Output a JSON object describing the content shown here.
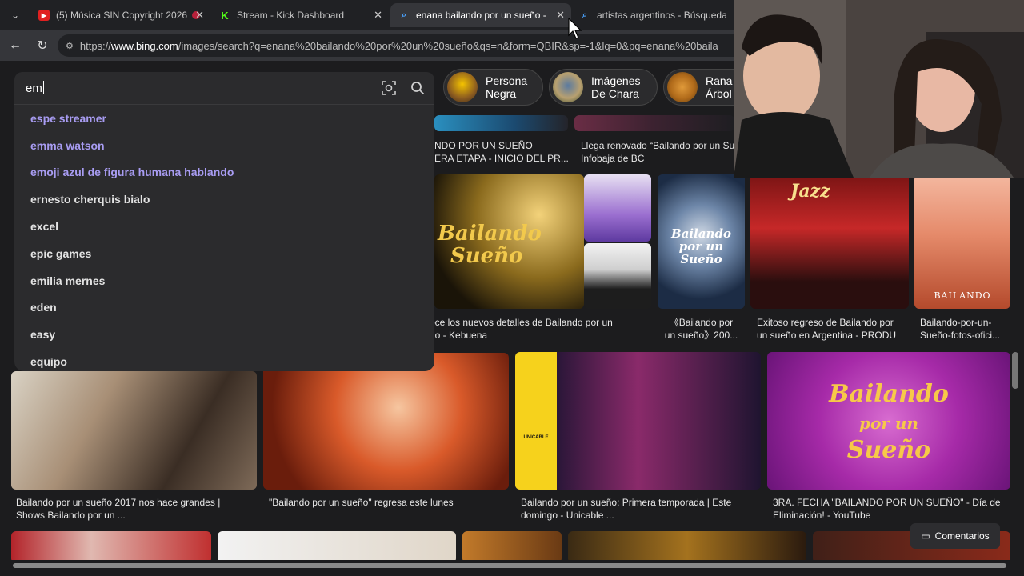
{
  "tabs": [
    {
      "title": "(5) Música SIN Copyright 2026",
      "icon": "youtube-icon"
    },
    {
      "title": "Stream - Kick Dashboard",
      "icon": "kick-icon"
    },
    {
      "title": "enana bailando por un sueño - Bú",
      "icon": "bing-search-icon"
    },
    {
      "title": "artistas argentinos - Búsqueda Imá",
      "icon": "bing-search-icon"
    }
  ],
  "address": {
    "prefix": "https://",
    "domain": "www.bing.com",
    "path": "/images/search?q=enana%20bailando%20por%20un%20sueño&qs=n&form=QBIR&sp=-1&lq=0&pq=enana%20baila"
  },
  "search": {
    "query": "em"
  },
  "suggestions": [
    {
      "text": "espe streamer",
      "visited": true
    },
    {
      "text": "emma watson",
      "visited": true
    },
    {
      "text": "emoji azul de figura humana hablando",
      "visited": true
    },
    {
      "text": "ernesto cherquis bialo",
      "visited": false
    },
    {
      "text": "excel",
      "visited": false
    },
    {
      "text": "epic games",
      "visited": false
    },
    {
      "text": "emilia mernes",
      "visited": false
    },
    {
      "text": "eden",
      "visited": false
    },
    {
      "text": "easy",
      "visited": false
    },
    {
      "text": "equipo",
      "visited": false
    }
  ],
  "chips": [
    {
      "line1": "Persona",
      "line2": "Negra"
    },
    {
      "line1": "Imágenes",
      "line2": "De Chara"
    },
    {
      "line1": "Rana",
      "line2": "Árbol"
    }
  ],
  "captions": {
    "top1a": "NDO POR UN SUEÑO",
    "top1b": "ERA ETAPA - INICIO DEL PR...",
    "top2a": "Llega renovado “Bailando por un Su",
    "top2b": "Infobaja de BC",
    "r2c1a": "oce los nuevos detalles de Bailando por un",
    "r2c1b": "ño - Kebuena",
    "r2c2a": "《Bailando por",
    "r2c2b": "un sueño》200...",
    "r2c3a": "Exitoso regreso de Bailando por",
    "r2c3b": "un sueño en Argentina - PRODU",
    "r2c4a": "Bailando-por-un-",
    "r2c4b": "Sueño-fotos-ofici...",
    "r3c1a": "Bailando por un sueño 2017 nos hace grandes |",
    "r3c1b": "Shows Bailando por un ...",
    "r3c2a": "\"Bailando por un sueño\" regresa este lunes",
    "r3c3a": "Bailando por un sueño: Primera temporada | Este",
    "r3c3b": "domingo - Unicable ...",
    "r3c4a": "3RA. FECHA \"BAILANDO POR UN SUEÑO\" - Día de",
    "r3c4b": "Eliminación! - YouTube"
  },
  "image_text": {
    "logo_bailando": "Bailando",
    "logo_sueno": "Sueño",
    "jazz": "Jazz",
    "unicable": "UNICABLE",
    "bailando_20": "BAILANDO",
    "bps_title1": "Bailando",
    "bps_title2": "por un",
    "bps_title3": "Sueño"
  },
  "feedback": {
    "label": "Comentarios"
  }
}
